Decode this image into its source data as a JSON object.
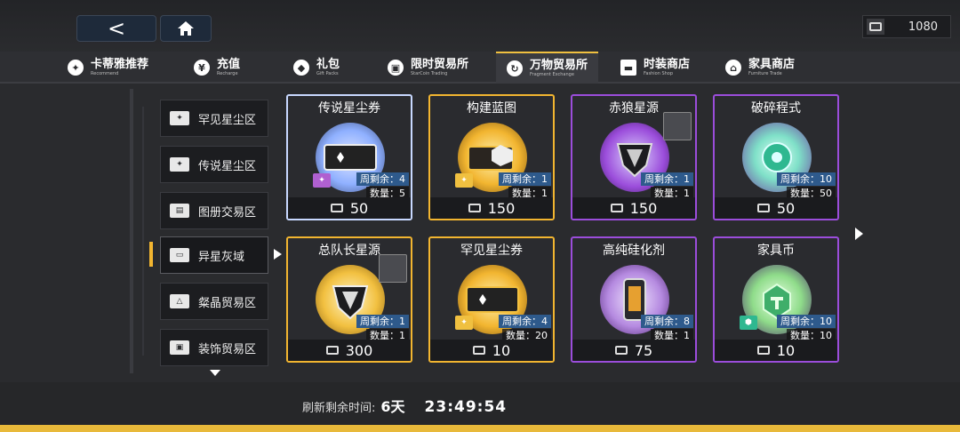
{
  "header": {
    "back_glyph": "<",
    "currency_amount": "1080"
  },
  "tabs": [
    {
      "label": "卡蒂雅推荐",
      "sub": "Recommend",
      "icon": "rabbit-icon"
    },
    {
      "label": "充值",
      "sub": "Recharge",
      "icon": "yen-icon"
    },
    {
      "label": "礼包",
      "sub": "Gift Packs",
      "icon": "gift-icon"
    },
    {
      "label": "限时贸易所",
      "sub": "StarCoin Trading",
      "icon": "trade-icon"
    },
    {
      "label": "万物贸易所",
      "sub": "Fragment Exchange",
      "icon": "exchange-icon"
    },
    {
      "label": "时装商店",
      "sub": "Fashion Shop",
      "icon": "fashion-icon"
    },
    {
      "label": "家具商店",
      "sub": "Furniture Trade",
      "icon": "furniture-icon"
    }
  ],
  "sidebar": {
    "items": [
      {
        "label": "罕见星尘区"
      },
      {
        "label": "传说星尘区"
      },
      {
        "label": "图册交易区"
      },
      {
        "label": "异星灰域"
      },
      {
        "label": "粲晶贸易区"
      },
      {
        "label": "装饰贸易区"
      }
    ]
  },
  "items": [
    {
      "name": "传说星尘券",
      "weekly": "周剩余：4",
      "count": "数量：5",
      "price": "50",
      "frame_color": "#c8d8ff"
    },
    {
      "name": "构建蓝图",
      "weekly": "周剩余：1",
      "count": "数量：1",
      "price": "150",
      "frame_color": "#f2b530"
    },
    {
      "name": "赤狼星源",
      "weekly": "周剩余：1",
      "count": "数量：1",
      "price": "150",
      "frame_color": "#9b4ddb"
    },
    {
      "name": "破碎程式",
      "weekly": "周剩余：10",
      "count": "数量：50",
      "price": "50",
      "frame_color": "#9b4ddb"
    },
    {
      "name": "总队长星源",
      "weekly": "周剩余：1",
      "count": "数量：1",
      "price": "300",
      "frame_color": "#f2b530"
    },
    {
      "name": "罕见星尘券",
      "weekly": "周剩余：4",
      "count": "数量：20",
      "price": "10",
      "frame_color": "#f2b530"
    },
    {
      "name": "高纯硅化剂",
      "weekly": "周剩余：8",
      "count": "数量：1",
      "price": "75",
      "frame_color": "#9b4ddb"
    },
    {
      "name": "家具币",
      "weekly": "周剩余：10",
      "count": "数量：10",
      "price": "10",
      "frame_color": "#9b4ddb"
    }
  ],
  "footer": {
    "refresh_label": "刷新剩余时间:",
    "days": "6天",
    "time": "23:49:54"
  }
}
